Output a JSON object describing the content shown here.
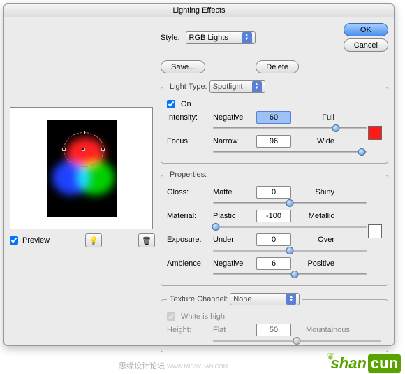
{
  "title": "Lighting Effects",
  "style": {
    "label": "Style:",
    "value": "RGB Lights",
    "save": "Save...",
    "delete": "Delete"
  },
  "buttons": {
    "ok": "OK",
    "cancel": "Cancel"
  },
  "lightType": {
    "legend": "Light Type:",
    "value": "Spotlight",
    "onLabel": "On",
    "intensity": {
      "label": "Intensity:",
      "left": "Negative",
      "right": "Full",
      "value": "60",
      "pos": 80
    },
    "focus": {
      "label": "Focus:",
      "left": "Narrow",
      "right": "Wide",
      "value": "96",
      "pos": 97
    },
    "swatch": "#ff1a1a"
  },
  "properties": {
    "legend": "Properties:",
    "gloss": {
      "label": "Gloss:",
      "left": "Matte",
      "right": "Shiny",
      "value": "0",
      "pos": 50
    },
    "material": {
      "label": "Material:",
      "left": "Plastic",
      "right": "Metallic",
      "value": "-100",
      "pos": 2
    },
    "exposure": {
      "label": "Exposure:",
      "left": "Under",
      "right": "Over",
      "value": "0",
      "pos": 50
    },
    "ambience": {
      "label": "Ambience:",
      "left": "Negative",
      "right": "Positive",
      "value": "6",
      "pos": 53
    },
    "swatch": "#ffffff"
  },
  "texture": {
    "legend": "Texture Channel:",
    "value": "None",
    "whiteHigh": "White is high",
    "height": {
      "label": "Height:",
      "left": "Flat",
      "right": "Mountainous",
      "value": "50",
      "pos": 50
    }
  },
  "preview": {
    "label": "Preview",
    "bulbIcon": "💡",
    "trashIcon": "🗑"
  },
  "footer": {
    "credit": "思缘设计论坛",
    "creditUrl": "WWW.MISSYUAN.COM",
    "brand1": "shan",
    "brand2": "cun"
  }
}
